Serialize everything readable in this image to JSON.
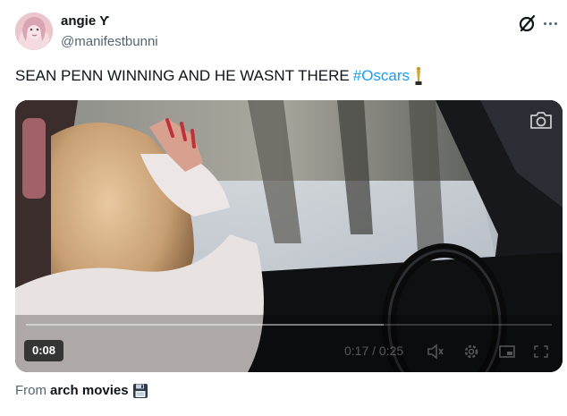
{
  "user": {
    "display_name": "angie",
    "name_glyph": "Ƴ",
    "handle": "@manifestbunni",
    "avatar_icon": "avatar-icon"
  },
  "tweet": {
    "text_main": "SEAN PENN WINNING AND HE WASNT THERE",
    "hashtag": "#Oscars",
    "emoji_icon": "trophy-icon"
  },
  "video": {
    "elapsed_badge": "0:08",
    "player_time": "0:17 / 0:25",
    "progress_fraction": 0.68
  },
  "source": {
    "prefix": "From",
    "name": "arch movies",
    "emoji_icon": "floppy-disk-icon"
  },
  "colors": {
    "accent": "#1d9bf0",
    "secondary_text": "#536471",
    "primary_text": "#0f1419"
  }
}
